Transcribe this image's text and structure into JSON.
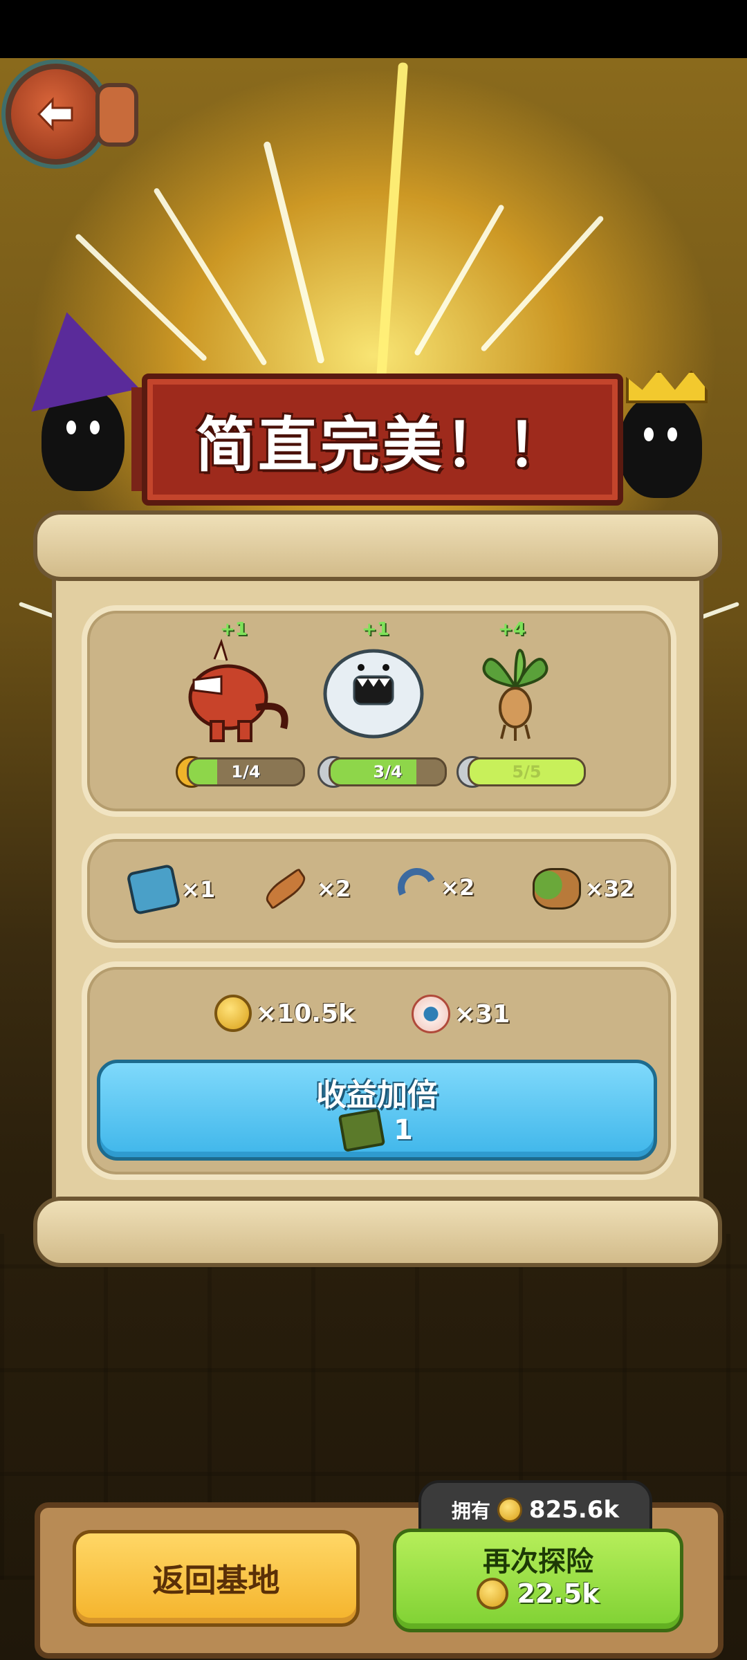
{
  "banner": {
    "title": "简直完美！！"
  },
  "creatures": [
    {
      "name_icon": "red-dinosaur-creature",
      "plus": "+1",
      "progress": "1/4",
      "progress_fraction": 0.25,
      "badge_icon": "yellow-cat-badge-icon"
    },
    {
      "name_icon": "white-yeti-creature",
      "plus": "+1",
      "progress": "3/4",
      "progress_fraction": 0.75,
      "badge_icon": "grey-cat-badge-icon"
    },
    {
      "name_icon": "mandrake-plant-creature",
      "plus": "+4",
      "progress": "5/5",
      "progress_fraction": 1.0,
      "badge_icon": "grey-cat-badge-icon"
    }
  ],
  "items": [
    {
      "icon": "blue-relic-icon",
      "qty": "×1"
    },
    {
      "icon": "feather-icon",
      "qty": "×2"
    },
    {
      "icon": "blue-worm-icon",
      "qty": "×2"
    },
    {
      "icon": "green-shell-icon",
      "qty": "×32"
    }
  ],
  "rewards": [
    {
      "icon": "gold-coin-icon",
      "qty": "×10.5k"
    },
    {
      "icon": "eyeball-icon",
      "qty": "×31"
    }
  ],
  "double_button": {
    "label": "收益加倍",
    "cost": "1",
    "cost_icon": "ticket-icon"
  },
  "bottom": {
    "return_label": "返回基地",
    "owned_label": "拥有",
    "owned_value": "825.6k",
    "again_label": "再次探险",
    "again_cost": "22.5k"
  },
  "colors": {
    "banner_red": "#9e2a1c",
    "parchment": "#e2cfa1",
    "double_blue": "#3fb6ea",
    "again_green": "#7fd133",
    "return_yellow": "#f4b32b"
  }
}
